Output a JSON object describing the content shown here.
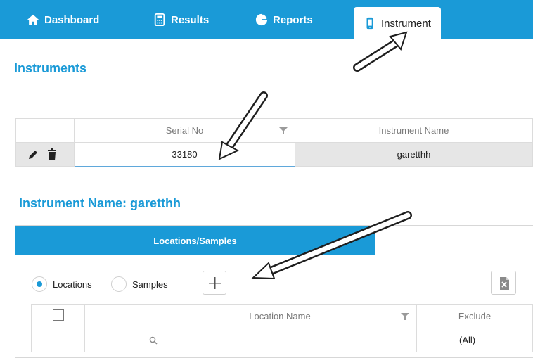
{
  "nav": {
    "tabs": [
      {
        "label": "Dashboard",
        "icon": "home-icon"
      },
      {
        "label": "Results",
        "icon": "calculator-icon"
      },
      {
        "label": "Reports",
        "icon": "pie-chart-icon"
      },
      {
        "label": "Instrument",
        "icon": "mobile-device-icon",
        "active": true
      }
    ]
  },
  "instruments": {
    "title": "Instruments",
    "columns": [
      "Serial No",
      "Instrument Name"
    ],
    "rows": [
      {
        "serial": "33180",
        "name": "garetthh"
      }
    ]
  },
  "detail": {
    "title": "Instrument Name: garetthh",
    "tab_label": "Locations/Samples",
    "radio": {
      "locations": "Locations",
      "samples": "Samples",
      "selected": "Locations"
    },
    "columns": [
      "Location Name",
      "Exclude"
    ],
    "filter_exclude": "(All)"
  },
  "colors": {
    "accent": "#1a9ad7"
  }
}
